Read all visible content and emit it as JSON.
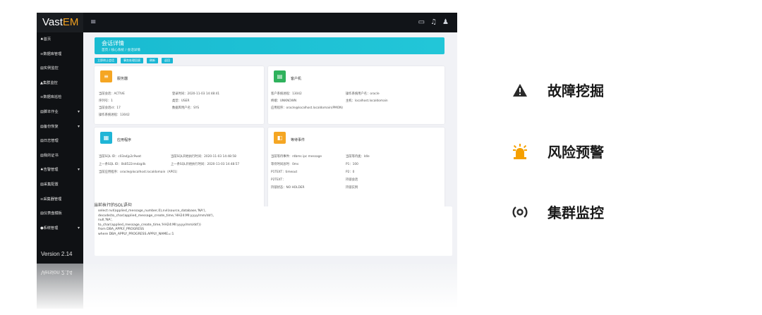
{
  "app": {
    "brand_a": "Vast",
    "brand_b": "EM",
    "version": "Version 2.14",
    "menu_icon": "menu-icon",
    "top_icons": [
      "monitor-icon",
      "bell-icon",
      "user-icon"
    ]
  },
  "sidebar": {
    "items": [
      {
        "label": "♠首页",
        "has_arrow": false
      },
      {
        "label": "≡数据库管理",
        "has_arrow": false
      },
      {
        "label": "▤实例监控",
        "has_arrow": false
      },
      {
        "label": "▲集群监控",
        "has_arrow": false
      },
      {
        "label": "≡数据库巡检",
        "has_arrow": false
      },
      {
        "label": "▤脚本作业",
        "has_arrow": true
      },
      {
        "label": "▤备份恢复",
        "has_arrow": true
      },
      {
        "label": "▤日志管理",
        "has_arrow": false
      },
      {
        "label": "▤我的证书",
        "has_arrow": false
      },
      {
        "label": "♠告警管理",
        "has_arrow": true
      },
      {
        "label": "▤采集配置",
        "has_arrow": false
      },
      {
        "label": "≡采集器管理",
        "has_arrow": false
      },
      {
        "label": "▤仪表盘模板",
        "has_arrow": false
      },
      {
        "label": "●系统管理",
        "has_arrow": true
      }
    ]
  },
  "page": {
    "title": "会话详情",
    "breadcrumb": "首页 / 核心系统 / 会话详情",
    "buttons": [
      "立即终止会话",
      "事务处理回滚",
      "刷新",
      "返回"
    ]
  },
  "cards": {
    "server": {
      "title": "服务器",
      "icon": "server-icon",
      "color": "#f5a623",
      "rows": [
        [
          "当前会话：ACTIVE",
          "登录时间：2020-11-03 14:48:41"
        ],
        [
          "序列号：1",
          "类型：USER"
        ],
        [
          "当前会话id：17",
          "数据库用户名：SYS"
        ],
        [
          "操作系统进程：13042",
          ""
        ]
      ]
    },
    "client": {
      "title": "客户机",
      "icon": "client-icon",
      "color": "#2fb25c",
      "rows": [
        [
          "客户系统进程：13042",
          "操作系统用户名：oracle"
        ],
        [
          "终端：UNKNOWN",
          "主机：localhost.localdomain"
        ],
        [
          "应用程序：oracle@localhost.localdomain(PMON)",
          ""
        ]
      ]
    },
    "application": {
      "title": "应用程序",
      "icon": "app-icon",
      "color": "#1fb5d6",
      "rows": [
        [
          "当前SQL ID：c03adjp2c9wat",
          "当前SQL开始执行时间：2020-11-03 14:48:58"
        ],
        [
          "上一条SQL ID：0k8522rmdzg4k",
          "上一条SQL开始执行时间：2020-11-03 14:48:57"
        ],
        [
          "当前应用程序：oracle@localhost.localdomain（AP01）",
          ""
        ]
      ]
    },
    "wait": {
      "title": "等待事件",
      "icon": "wait-icon",
      "color": "#f5a623",
      "rows": [
        [
          "当前等待事件：rdbms ipc message",
          "当前等待类：Idle"
        ],
        [
          "等待时间总时：0ms",
          "P1：100"
        ],
        [
          "P1TEXT：timeout",
          "P2：0"
        ],
        [
          "P2TEXT：",
          "持锁会话"
        ],
        [
          "持锁状态：NO HOLDER",
          "持锁实例"
        ]
      ]
    }
  },
  "sql": {
    "label": "当前执行的SQL语句",
    "lines": [
      "select nvl(applied_message_number,0),nvl(source_database,'NA'),",
      "decode(to_char(applied_message_create_time,'HH24:MI:yyyy/mm/dd'),",
      "null,'NA',",
      "to_char(applied_message_create_time,'HH24:MI:yyyy/mm/dd'))",
      "from DBA_APPLY_PROGRESS",
      "where DBA_APPLY_PROGRESS.APPLY_NAME=:1"
    ]
  },
  "features": [
    {
      "label": "故障挖掘",
      "icon": "warning-icon"
    },
    {
      "label": "风险预警",
      "icon": "alarm-light-icon",
      "color": "#f5a000"
    },
    {
      "label": "集群监控",
      "icon": "cluster-monitor-icon"
    }
  ]
}
